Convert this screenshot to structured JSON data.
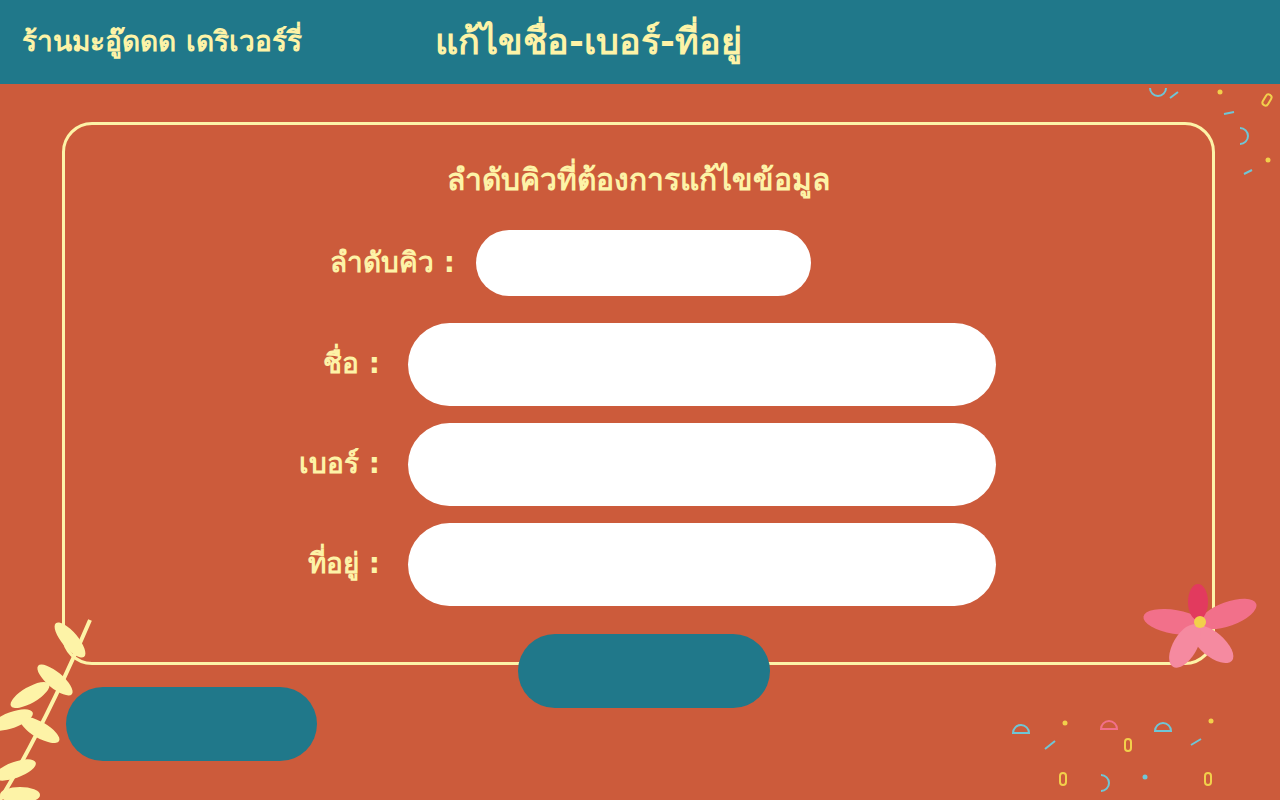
{
  "header": {
    "store_name": "ร้านมะอู๊ดดด เดริเวอร์รี่",
    "page_title": "แก้ไขชื่อ-เบอร์-ที่อยู่"
  },
  "form": {
    "heading": "ลำดับคิวที่ต้องการแก้ไขข้อมูล",
    "fields": [
      {
        "kind": "short",
        "label": "ลำดับคิว :",
        "value": ""
      },
      {
        "kind": "wide",
        "label": "ชื่อ :",
        "value": ""
      },
      {
        "kind": "wide",
        "label": "เบอร์ :",
        "value": ""
      },
      {
        "kind": "wide",
        "label": "ที่อยู่ :",
        "value": ""
      }
    ]
  }
}
